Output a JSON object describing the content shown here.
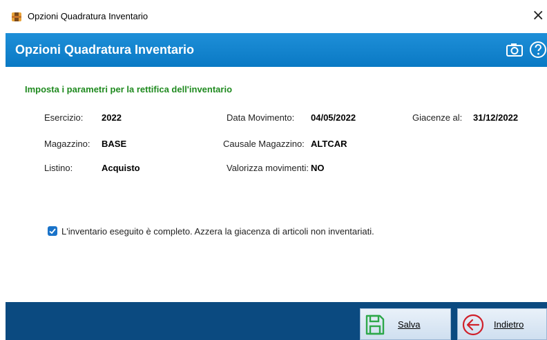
{
  "window": {
    "title": "Opzioni Quadratura Inventario",
    "close": "×"
  },
  "header": {
    "title": "Opzioni Quadratura Inventario",
    "camera_icon": "camera-icon",
    "help_icon": "help-icon"
  },
  "form": {
    "subtitle": "Imposta i parametri per la rettifica dell'inventario",
    "esercizio_label": "Esercizio:",
    "esercizio_value": "2022",
    "data_movimento_label": "Data Movimento:",
    "data_movimento_value": "04/05/2022",
    "giacenze_label": "Giacenze al:",
    "giacenze_value": "31/12/2022",
    "magazzino_label": "Magazzino:",
    "magazzino_value": "BASE",
    "causale_label": "Causale Magazzino:",
    "causale_value": "ALTCAR",
    "listino_label": "Listino:",
    "listino_value": "Acquisto",
    "valorizza_label": "Valorizza movimenti:",
    "valorizza_value": "NO"
  },
  "checkbox": {
    "checked": true,
    "label": "L'inventario eseguito è completo. Azzera la giacenza di articoli non inventariati."
  },
  "footer": {
    "save_label": "Salva",
    "back_label": "Indietro"
  },
  "colors": {
    "header_blue": "#0a79c4",
    "subtitle_green": "#1f8a1f",
    "footer_blue": "#0b4a80",
    "save_icon_green": "#2ea84a",
    "back_icon_red": "#d0202a"
  }
}
